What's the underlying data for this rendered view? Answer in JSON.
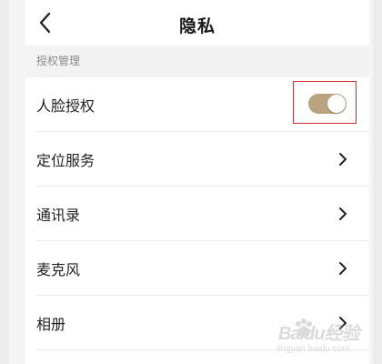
{
  "header": {
    "title": "隐私",
    "back_icon": "chevron-left-icon"
  },
  "section": {
    "title": "授权管理"
  },
  "items": [
    {
      "label": "人脸授权",
      "control": "toggle",
      "toggle_on": true,
      "toggle_color": "#b9a47f"
    },
    {
      "label": "定位服务",
      "control": "chevron"
    },
    {
      "label": "通讯录",
      "control": "chevron"
    },
    {
      "label": "麦克风",
      "control": "chevron"
    },
    {
      "label": "相册",
      "control": "chevron"
    }
  ],
  "watermark": {
    "text": "Baidu经验",
    "url": "jingyan.baidu.com"
  }
}
